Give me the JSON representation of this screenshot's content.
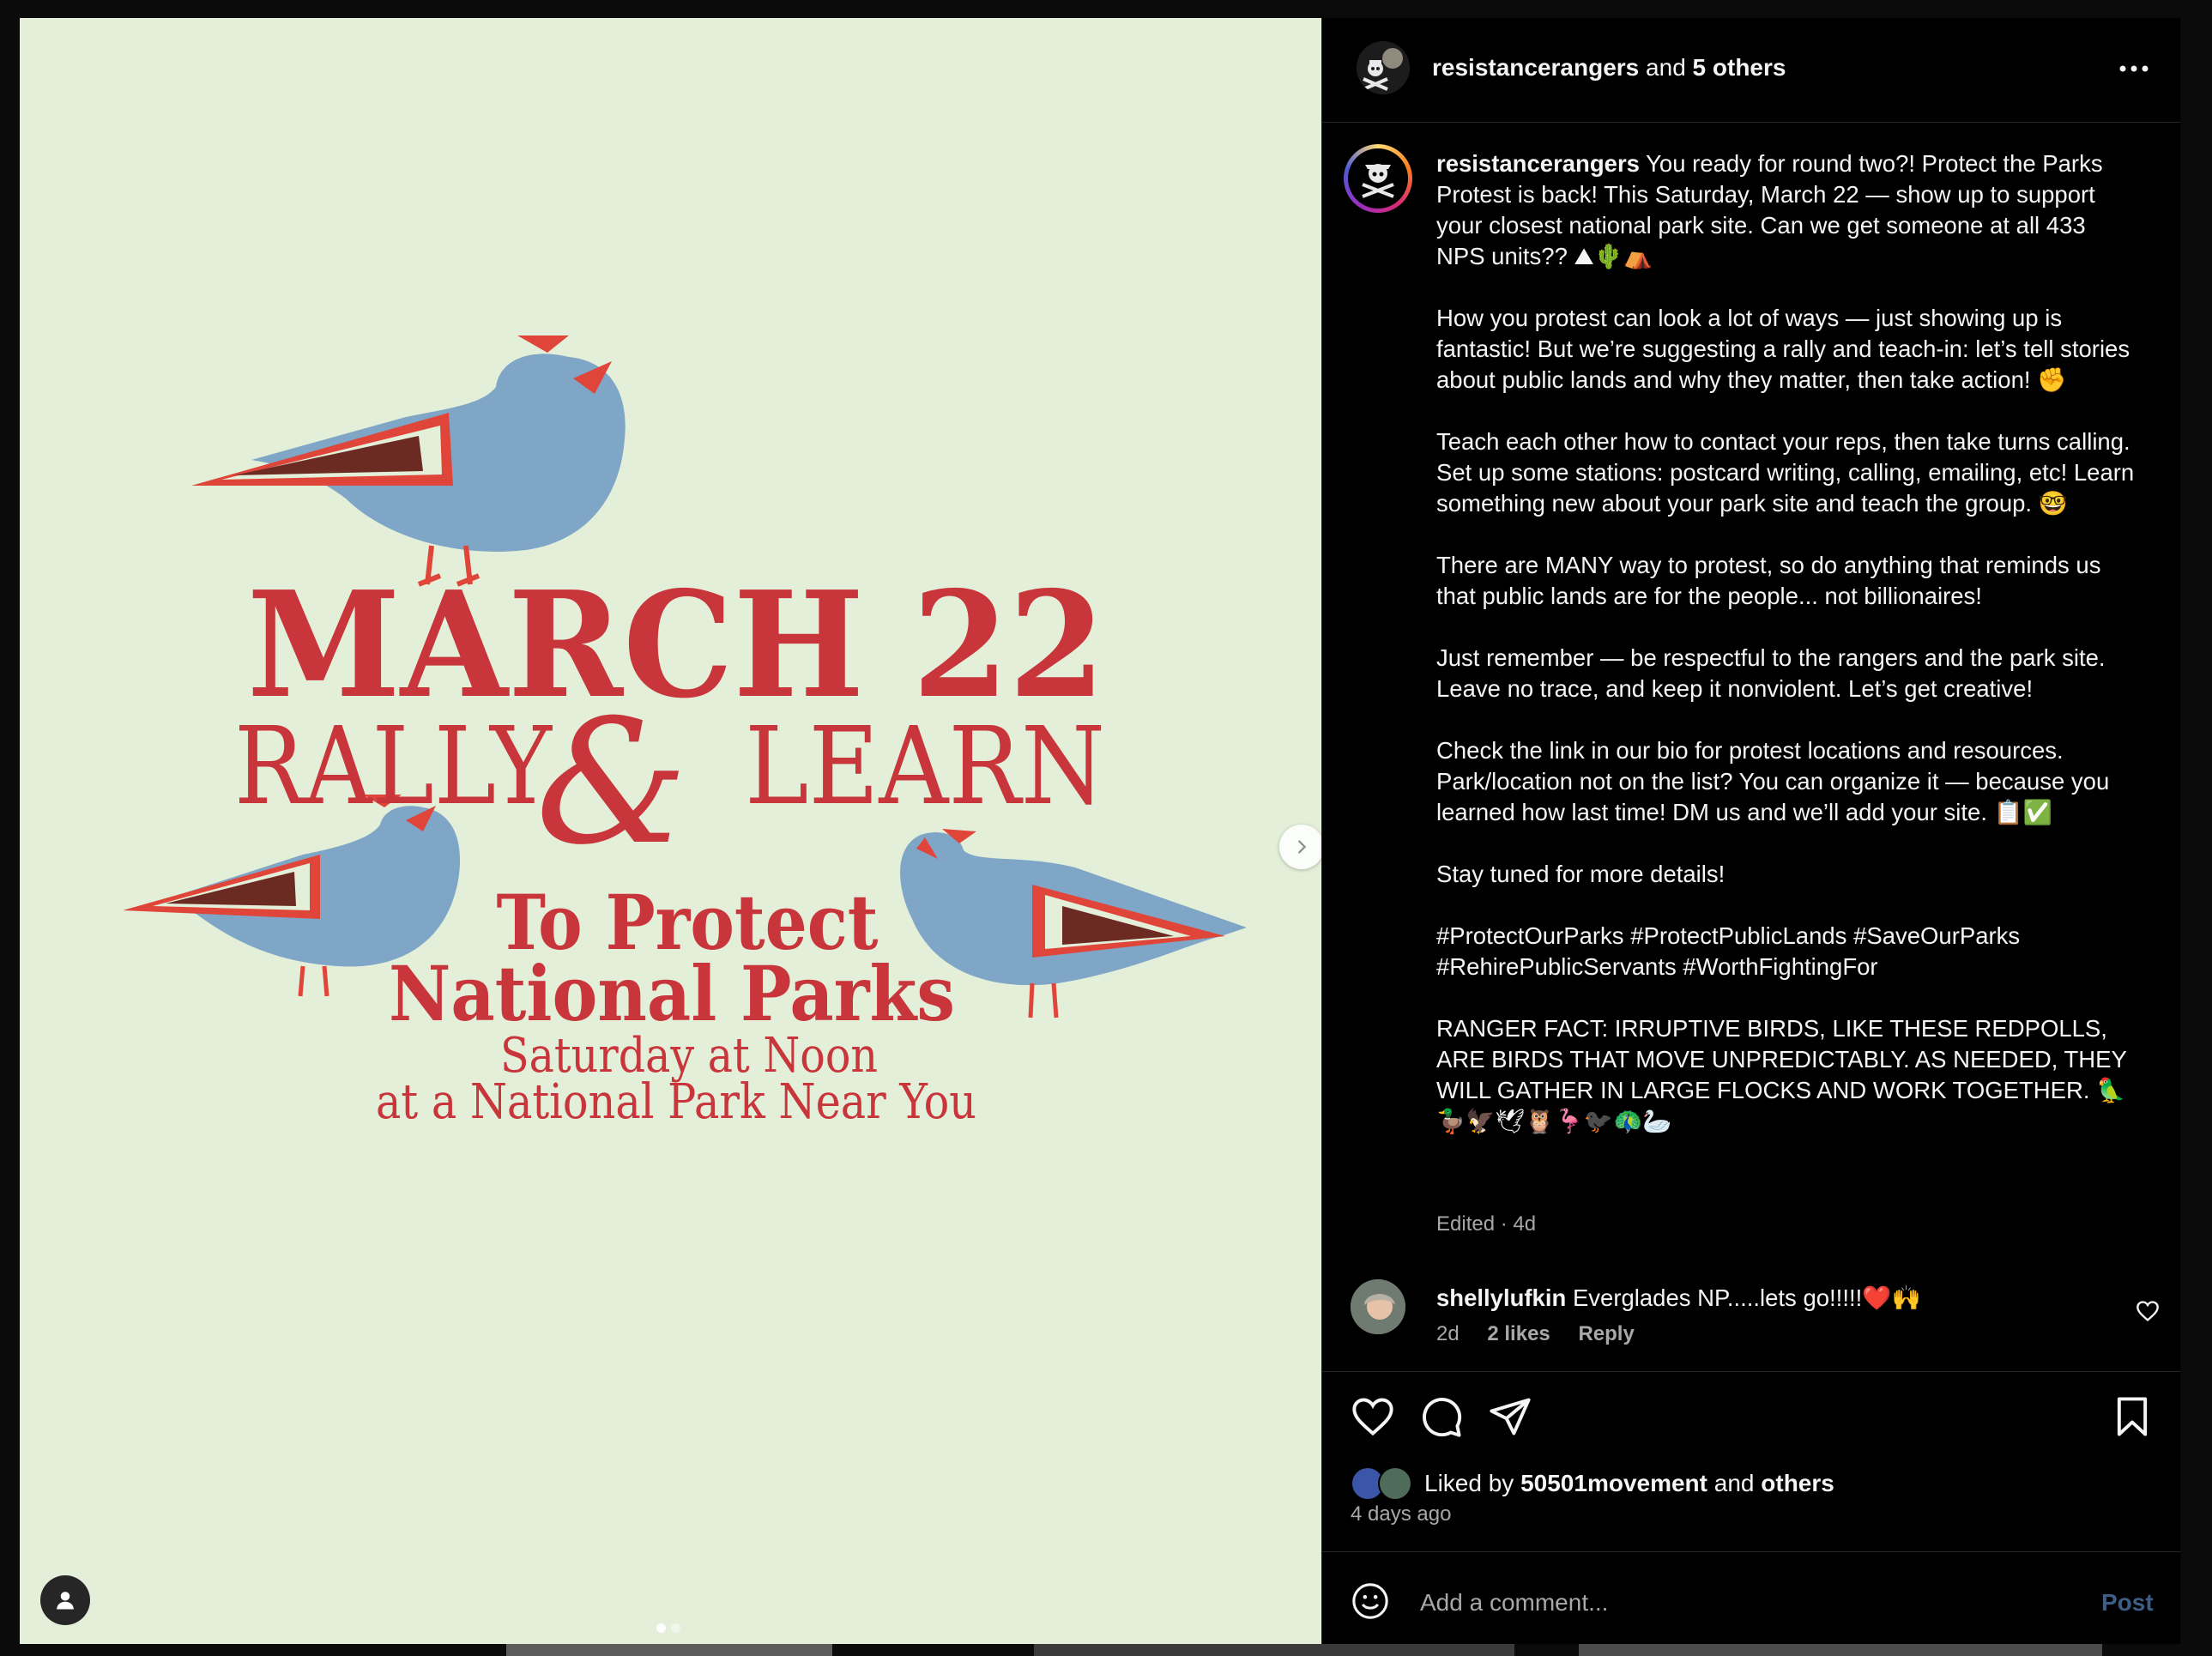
{
  "poster": {
    "line1": "MARCH 22",
    "line2_left": "RALLY",
    "line2_amp": "&",
    "line2_right": "LEARN",
    "line3": "To Protect",
    "line4": "National Parks",
    "line5": "Saturday at Noon",
    "line6": "at a National Park Near You"
  },
  "carousel": {
    "current": 1,
    "total": 2
  },
  "header": {
    "username": "resistancerangers",
    "and_text": "and",
    "others": "5 others",
    "more_icon": "more-horizontal-icon"
  },
  "caption": {
    "username": "resistancerangers",
    "paragraphs": [
      "You ready for round two?! Protect the Parks Protest is back! This Saturday, March 22 — show up to support your closest national park site. Can we get someone at all 433 NPS units?? ⛰🌵⛺",
      "How you protest can look a lot of ways — just showing up is fantastic! But we’re suggesting a rally and teach-in: let’s tell stories about public lands and why they matter, then take action! ✊",
      "Teach each other how to contact your reps, then take turns calling. Set up some stations: postcard writing, calling, emailing, etc! Learn something new about your park site and teach the group. 🤓",
      "There are MANY way to protest, so do anything that reminds us that public lands are for the people... not billionaires!",
      "Just remember — be respectful to the rangers and the park site. Leave no trace, and keep it nonviolent. Let’s get creative!",
      "Check the link in our bio for protest locations and resources. Park/location not on the list? You can organize it — because you learned how last time! DM us and we’ll add your site. 📋✅",
      "Stay tuned for more details!",
      "#ProtectOurParks #ProtectPublicLands #SaveOurParks #RehirePublicServants #WorthFightingFor",
      "RANGER FACT: IRRUPTIVE BIRDS, LIKE THESE REDPOLLS, ARE BIRDS THAT MOVE UNPREDICTABLY. AS NEEDED, THEY WILL GATHER IN LARGE FLOCKS AND WORK TOGETHER. 🦜\n🦆🦅🕊🦉🦩🐦‍⬛🦚🦢"
    ],
    "edited": "Edited · 4d"
  },
  "comment": {
    "username": "shellylufkin",
    "text": "Everglades NP.....lets go!!!!!❤️🙌",
    "age": "2d",
    "likes": "2 likes",
    "reply": "Reply"
  },
  "actions": {
    "liked_prefix": "Liked by",
    "liked_user": "50501movement",
    "liked_and": "and",
    "liked_others": "others",
    "time_ago": "4 days ago"
  },
  "add_comment": {
    "placeholder": "Add a comment...",
    "post_label": "Post"
  },
  "colors": {
    "poster_bg": "#e3efd9",
    "poster_red": "#c8353a",
    "bird_blue": "#7fa6c6",
    "post_blue": "#3e5e87"
  }
}
